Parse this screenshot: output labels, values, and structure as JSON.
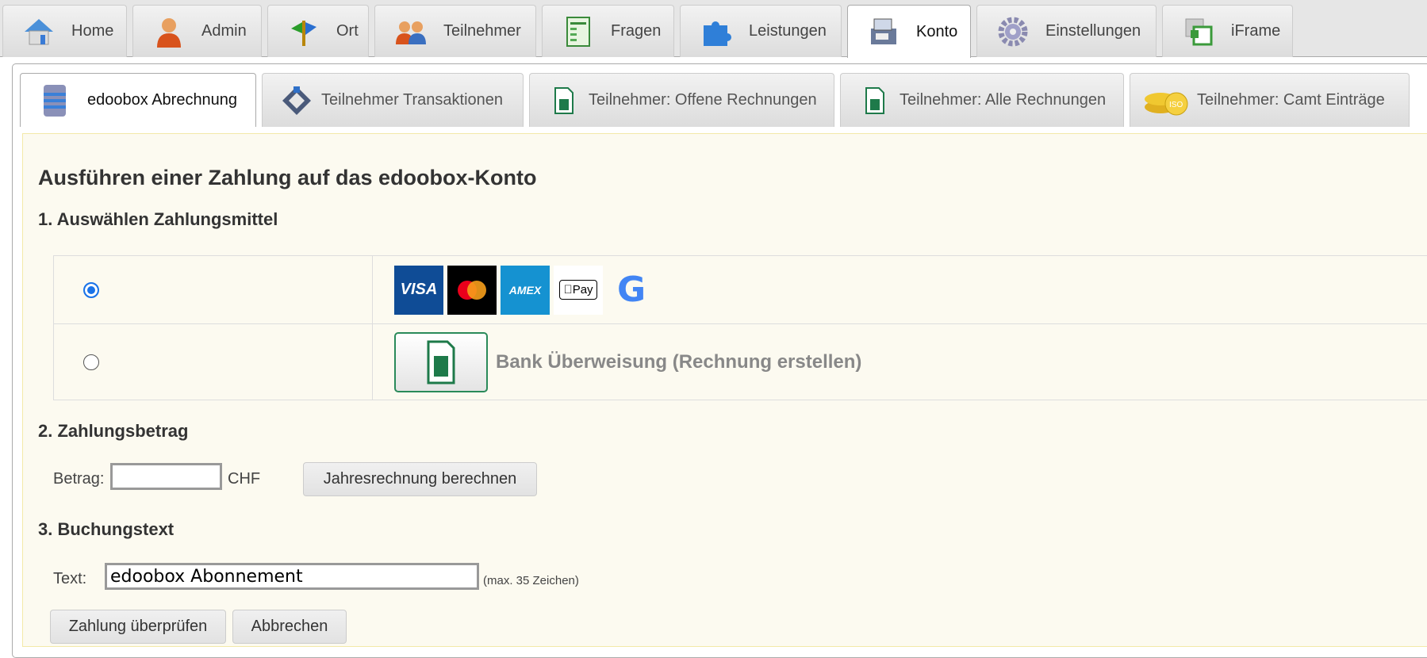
{
  "top_tabs": [
    {
      "label": "Home",
      "icon": "home-icon"
    },
    {
      "label": "Admin",
      "icon": "admin-user-icon"
    },
    {
      "label": "Ort",
      "icon": "signpost-icon"
    },
    {
      "label": "Teilnehmer",
      "icon": "participants-icon"
    },
    {
      "label": "Fragen",
      "icon": "questions-form-icon"
    },
    {
      "label": "Leistungen",
      "icon": "puzzle-icon"
    },
    {
      "label": "Konto",
      "icon": "cash-register-icon",
      "active": true
    },
    {
      "label": "Einstellungen",
      "icon": "gear-icon"
    },
    {
      "label": "iFrame",
      "icon": "iframe-icon"
    }
  ],
  "sub_tabs": [
    {
      "label": "edoobox Abrechnung",
      "icon": "server-stack-icon",
      "active": true
    },
    {
      "label": "Teilnehmer Transaktionen",
      "icon": "transactions-icon"
    },
    {
      "label": "Teilnehmer: Offene Rechnungen",
      "icon": "invoice-icon"
    },
    {
      "label": "Teilnehmer: Alle Rechnungen",
      "icon": "invoice-icon"
    },
    {
      "label": "Teilnehmer: Camt Einträge",
      "icon": "iso-coins-icon"
    }
  ],
  "page_title": "Ausführen einer Zahlung auf das edoobox-Konto",
  "section1": {
    "title": "1. Auswählen Zahlungsmittel",
    "cards": {
      "visa": "VISA",
      "amex": "AMEX",
      "applepay": "Pay",
      "google": "G"
    },
    "bank_label": "Bank Überweisung (Rechnung erstellen)",
    "selected": "card"
  },
  "section2": {
    "title": "2. Zahlungsbetrag",
    "amount_label": "Betrag:",
    "amount_value": "",
    "currency": "CHF",
    "calc_button": "Jahresrechnung berechnen"
  },
  "section3": {
    "title": "3. Buchungstext",
    "text_label": "Text:",
    "text_value": "edoobox Abonnement",
    "hint": "(max. 35 Zeichen)"
  },
  "actions": {
    "submit": "Zahlung überprüfen",
    "cancel": "Abbrechen"
  }
}
